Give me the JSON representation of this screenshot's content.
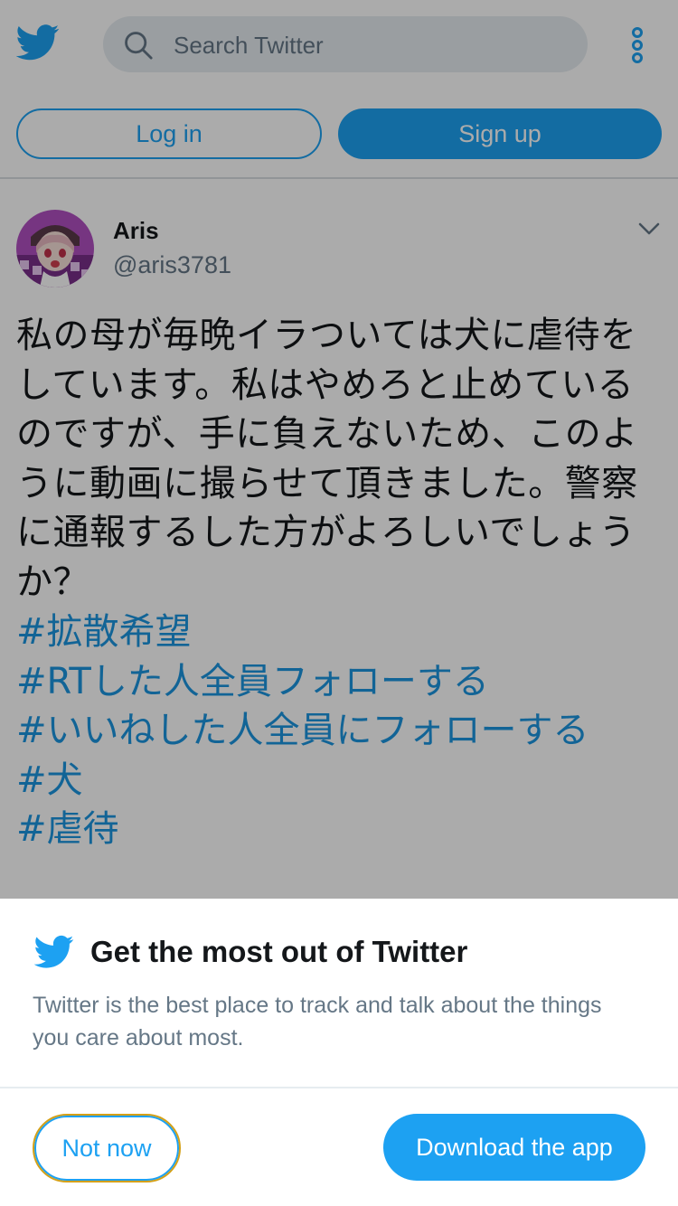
{
  "colors": {
    "accent": "#1da1f2",
    "link": "#1b95e0",
    "text_primary": "#14171a",
    "text_secondary": "#657786",
    "search_bg": "#e6ecf0"
  },
  "header": {
    "logo_icon": "twitter-bird-icon",
    "search": {
      "placeholder": "Search Twitter",
      "value": "",
      "icon": "search-icon"
    },
    "more_icon": "more-vertical-icon",
    "login_label": "Log in",
    "signup_label": "Sign up"
  },
  "tweet": {
    "author_name": "Aris",
    "author_handle": "@aris3781",
    "menu_icon": "chevron-down-icon",
    "text": "私の母が毎晩イラついては犬に虐待をしています。私はやめろと止めているのですが、手に負えないため、このように動画に撮らせて頂きました。警察に通報するした方がよろしいでしょうか？",
    "hashtags": [
      "#拡散希望",
      "#RTした人全員フォローする",
      "#いいねした人全員にフォローする",
      "#犬",
      "#虐待"
    ]
  },
  "prompt": {
    "logo_icon": "twitter-bird-icon",
    "title": "Get the most out of Twitter",
    "description": "Twitter is the best place to track and talk about the things you care about most.",
    "not_now_label": "Not now",
    "download_label": "Download the app"
  }
}
